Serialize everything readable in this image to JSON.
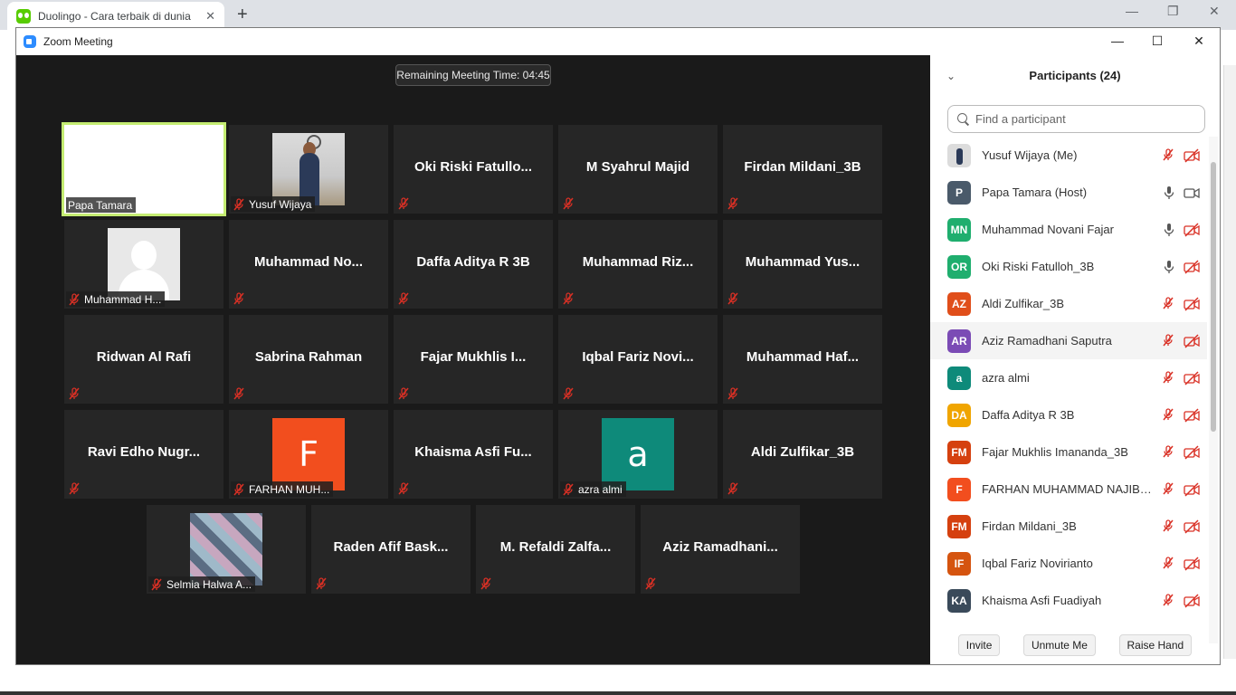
{
  "browser": {
    "tab_title": "Duolingo - Cara terbaik di dunia",
    "tab_close": "✕",
    "new_tab": "+",
    "minimize": "—",
    "restore": "❐",
    "close": "✕"
  },
  "zoom": {
    "title": "Zoom Meeting",
    "minimize": "—",
    "maximize": "☐",
    "close": "✕",
    "timer": "Remaining Meeting Time: 04:45"
  },
  "tiles": [
    {
      "name": "Papa Tamara",
      "label": "Papa Tamara"
    },
    {
      "name": "Yusuf Wijaya",
      "label": "Yusuf Wijaya"
    },
    {
      "name": "Oki  Riski  Fatullo..."
    },
    {
      "name": "M Syahrul Majid"
    },
    {
      "name": "Firdan Mildani_3B"
    },
    {
      "name": "Muhammad H...",
      "label": "Muhammad H..."
    },
    {
      "name": "Muhammad  No..."
    },
    {
      "name": "Daffa Aditya R 3B"
    },
    {
      "name": "Muhammad  Riz..."
    },
    {
      "name": "Muhammad  Yus..."
    },
    {
      "name": "Ridwan Al Rafi"
    },
    {
      "name": "Sabrina Rahman"
    },
    {
      "name": "Fajar  Mukhlis  I..."
    },
    {
      "name": "Iqbal  Fariz  Novi..."
    },
    {
      "name": "Muhammad  Haf..."
    },
    {
      "name": "Ravi  Edho  Nugr..."
    },
    {
      "name": "FARHAN MUH...",
      "label": "FARHAN MUH...",
      "letter": "F",
      "color": "#f24e1e"
    },
    {
      "name": "Khaisma  Asfi  Fu..."
    },
    {
      "name": "azra almi",
      "label": "azra almi",
      "letter": "a",
      "color": "#0e8a7a"
    },
    {
      "name": "Aldi Zulfikar_3B"
    },
    {
      "name": "Selmia Halwa A...",
      "label": "Selmia Halwa A..."
    },
    {
      "name": "Raden  Afif  Bask..."
    },
    {
      "name": "M.  Refaldi  Zalfa..."
    },
    {
      "name": "Aziz  Ramadhani..."
    }
  ],
  "panel": {
    "title": "Participants (24)",
    "search_placeholder": "Find a participant",
    "participants": [
      {
        "name": "Yusuf Wijaya (Me)",
        "initials": "",
        "color": "#dcdcdc",
        "mic": "muted",
        "cam": "off"
      },
      {
        "name": "Papa Tamara (Host)",
        "initials": "P",
        "color": "#4a5a6a",
        "mic": "on",
        "cam": "on"
      },
      {
        "name": "Muhammad Novani Fajar",
        "initials": "MN",
        "color": "#1fae6e",
        "mic": "on",
        "cam": "off"
      },
      {
        "name": "Oki Riski Fatulloh_3B",
        "initials": "OR",
        "color": "#1fae6e",
        "mic": "on",
        "cam": "off"
      },
      {
        "name": "Aldi Zulfikar_3B",
        "initials": "AZ",
        "color": "#e04e1a",
        "mic": "muted",
        "cam": "off"
      },
      {
        "name": "Aziz Ramadhani Saputra",
        "initials": "AR",
        "color": "#7b4bb5",
        "mic": "muted",
        "cam": "off"
      },
      {
        "name": "azra almi",
        "initials": "a",
        "color": "#0e8a7a",
        "mic": "muted",
        "cam": "off"
      },
      {
        "name": "Daffa Aditya R 3B",
        "initials": "DA",
        "color": "#f0a500",
        "mic": "muted",
        "cam": "off"
      },
      {
        "name": "Fajar Mukhlis Imananda_3B",
        "initials": "FM",
        "color": "#d5400f",
        "mic": "muted",
        "cam": "off"
      },
      {
        "name": "FARHAN MUHAMMAD NAJIB 2...",
        "initials": "F",
        "color": "#f24e1e",
        "mic": "muted",
        "cam": "off"
      },
      {
        "name": "Firdan Mildani_3B",
        "initials": "FM",
        "color": "#d5400f",
        "mic": "muted",
        "cam": "off"
      },
      {
        "name": "Iqbal Fariz Novirianto",
        "initials": "IF",
        "color": "#d5540f",
        "mic": "muted",
        "cam": "off"
      },
      {
        "name": "Khaisma Asfi Fuadiyah",
        "initials": "KA",
        "color": "#3a4a5a",
        "mic": "muted",
        "cam": "off"
      }
    ],
    "invite": "Invite",
    "unmute": "Unmute Me",
    "raise_hand": "Raise Hand"
  },
  "colors": {
    "muted_red": "#d93025",
    "active_speaker": "#c4ec72"
  }
}
